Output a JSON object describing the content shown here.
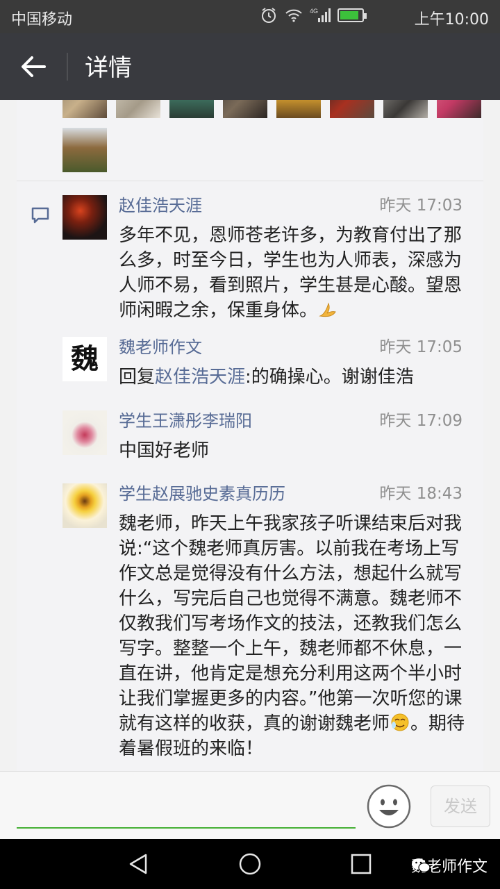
{
  "status_bar": {
    "carrier": "中国移动",
    "network": "4G",
    "time": "上午10:00",
    "battery_level": 0.85,
    "icons": [
      "alarm-icon",
      "wifi-icon",
      "signal-icon",
      "battery-icon"
    ]
  },
  "app_bar": {
    "title": "详情",
    "back_icon": "back-arrow-icon"
  },
  "photos": {
    "count": 10
  },
  "comments": [
    {
      "name": "赵佳浩天涯",
      "time": "昨天 17:03",
      "text": "多年不见，恩师苍老许多，为教育付出了那么多，时至今日，学生也为人师表，深感为人师不易，看到照片，学生甚是心酸。望恩师闲暇之余，保重身体。",
      "emoji": "folded-hands-emoji"
    },
    {
      "name": "魏老师作文",
      "avatar_text": "魏",
      "time": "昨天 17:05",
      "reply_prefix": "回复",
      "reply_to": "赵佳浩天涯",
      "text": ":的确操心。谢谢佳浩"
    },
    {
      "name": "学生王潇彤李瑞阳",
      "time": "昨天 17:09",
      "text": "中国好老师"
    },
    {
      "name": "学生赵展驰史素真历历",
      "time": "昨天 18:43",
      "text": "魏老师，昨天上午我家孩子听课结束后对我说:“这个魏老师真厉害。以前我在考场上写作文总是觉得没有什么方法，想起什么就写什么，写完后自己也觉得不满意。魏老师不仅教我们写考场作文的技法，还教我们怎么写字。整整一个上午，魏老师都不休息，一直在讲，他肯定是想充分利用这两个半小时让我们掌握更多的内容。”他第一次听您的课就有这样的收获，真的谢谢魏老师",
      "emoji": "teary-smile-emoji",
      "text_after": "。期待着暑假班的来临！"
    }
  ],
  "input_bar": {
    "placeholder": "",
    "send_label": "发送",
    "emoji_icon": "smiley-face-icon"
  },
  "nav_bar": {
    "buttons": [
      "back-triangle-icon",
      "home-circle-icon",
      "recents-square-icon"
    ]
  },
  "watermark": {
    "text": "魏老师作文"
  },
  "colors": {
    "app_bar": "#393a3f",
    "status_bar": "#3a3a3a",
    "link_blue": "#576b95",
    "input_underline": "#45b035",
    "battery_green": "#3cc13b"
  }
}
